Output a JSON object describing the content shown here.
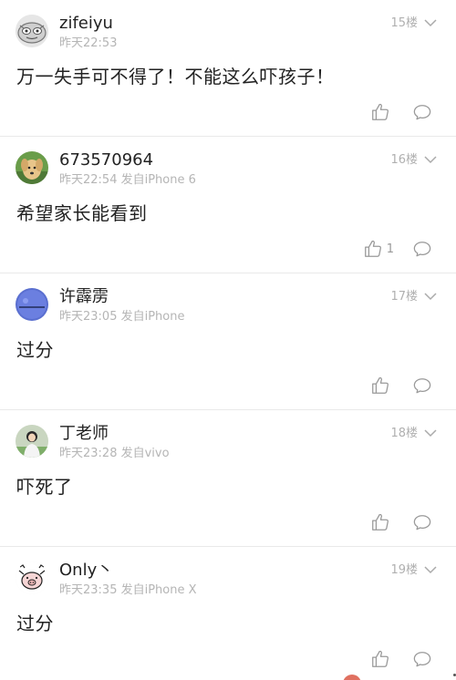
{
  "comments": [
    {
      "username": "zifeiyu",
      "meta": "昨天22:53",
      "floor": "15楼",
      "content": "万一失手可不得了！不能这么吓孩子！",
      "likes": ""
    },
    {
      "username": "673570964",
      "meta": "昨天22:54 发自iPhone 6",
      "floor": "16楼",
      "content": "希望家长能看到",
      "likes": "1"
    },
    {
      "username": "许霹雳",
      "meta": "昨天23:05 发自iPhone",
      "floor": "17楼",
      "content": "过分",
      "likes": ""
    },
    {
      "username": "丁老师",
      "meta": "昨天23:28 发自vivo",
      "floor": "18楼",
      "content": "吓死了",
      "likes": ""
    },
    {
      "username": "Only丶",
      "meta": "昨天23:35 发自iPhone X",
      "floor": "19楼",
      "content": "过分",
      "likes": ""
    }
  ],
  "icons": {
    "like": "thumbs-up-icon",
    "reply": "speech-bubble-icon",
    "more": "chevron-down-icon"
  },
  "colors": {
    "text": "#222222",
    "meta": "#b5b5b5",
    "icon": "#999999",
    "divider": "#e9e9e9"
  }
}
